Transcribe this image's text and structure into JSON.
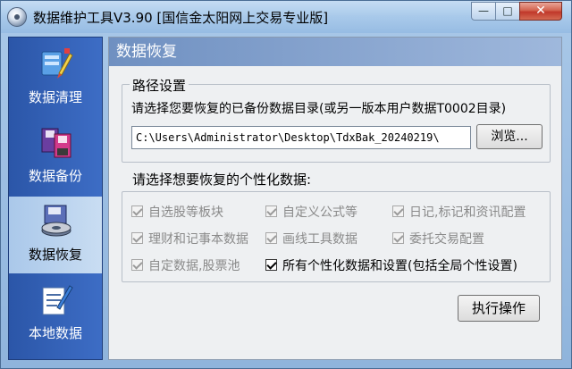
{
  "window": {
    "title": "数据维护工具V3.90 [国信金太阳网上交易专业版]",
    "minimize_glyph": "—",
    "maximize_glyph": "□",
    "close_glyph": "✕"
  },
  "sidebar": {
    "items": [
      {
        "label": "数据清理",
        "icon": "data-clean-icon"
      },
      {
        "label": "数据备份",
        "icon": "data-backup-icon"
      },
      {
        "label": "数据恢复",
        "icon": "data-restore-icon",
        "active": true
      },
      {
        "label": "本地数据",
        "icon": "local-data-icon"
      }
    ]
  },
  "main": {
    "section_title": "数据恢复",
    "path_group": {
      "legend": "路径设置",
      "hint": "请选择您要恢复的已备份数据目录(或另一版本用户数据T0002目录)",
      "path_value": "C:\\Users\\Administrator\\Desktop\\TdxBak_20240219\\",
      "browse_label": "浏览..."
    },
    "select_label": "请选择想要恢复的个性化数据:",
    "options": [
      {
        "label": "自选股等板块",
        "checked": true,
        "enabled": false
      },
      {
        "label": "自定义公式等",
        "checked": true,
        "enabled": false
      },
      {
        "label": "日记,标记和资讯配置",
        "checked": true,
        "enabled": false
      },
      {
        "label": "理财和记事本数据",
        "checked": true,
        "enabled": false
      },
      {
        "label": "画线工具数据",
        "checked": true,
        "enabled": false
      },
      {
        "label": "委托交易配置",
        "checked": true,
        "enabled": false
      },
      {
        "label": "自定数据,股票池",
        "checked": true,
        "enabled": false
      },
      {
        "label": "所有个性化数据和设置(包括全局个性设置)",
        "checked": true,
        "enabled": true
      }
    ],
    "execute_label": "执行操作"
  },
  "colors": {
    "sidebar_bg": "#2b56a8",
    "active_item_bg": "#aac8ea",
    "header_bg": "#6f90c1",
    "close_button": "#c0382a"
  }
}
